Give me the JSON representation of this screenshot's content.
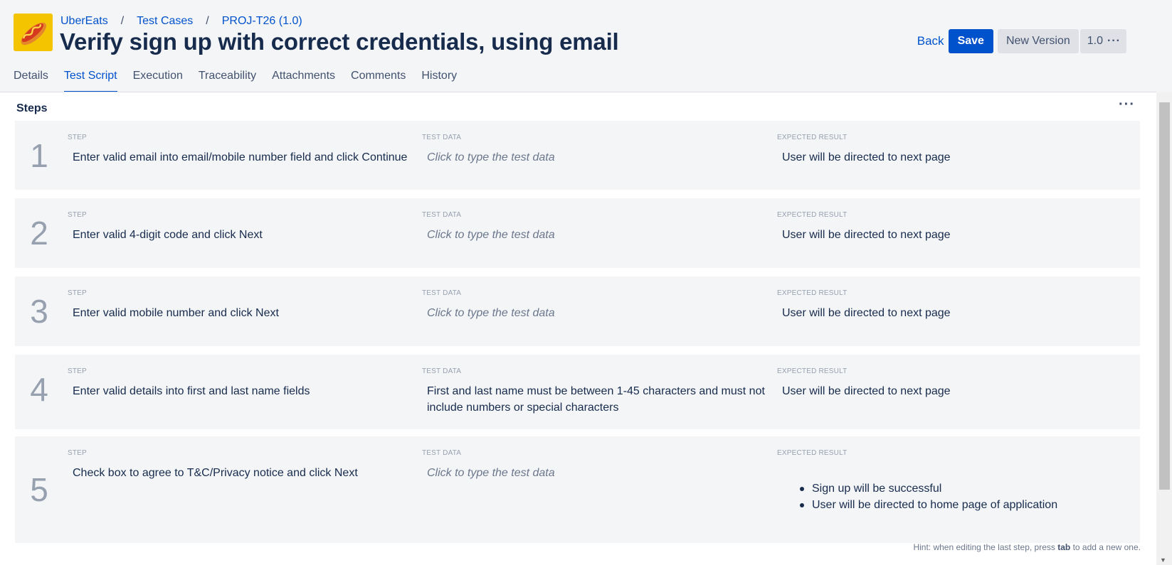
{
  "breadcrumb": [
    "UberEats",
    "Test Cases",
    "PROJ-T26 (1.0)"
  ],
  "title": "Verify sign up with correct credentials, using email",
  "actions": {
    "back": "Back",
    "save": "Save",
    "new_version": "New Version",
    "version": "1.0"
  },
  "tabs": [
    "Details",
    "Test Script",
    "Execution",
    "Traceability",
    "Attachments",
    "Comments",
    "History"
  ],
  "active_tab": "Test Script",
  "steps_title": "Steps",
  "column_labels": {
    "step": "STEP",
    "test_data": "TEST DATA",
    "expected": "EXPECTED RESULT"
  },
  "steps": [
    {
      "num": "1",
      "step": "Enter valid email into email/mobile number field and click Continue",
      "test_data": "Click to type the test data",
      "expected": "User will be directed to next page"
    },
    {
      "num": "2",
      "step": "Enter valid 4-digit code and click Next",
      "test_data": "Click to type the test data",
      "expected": "User will be directed to next page"
    },
    {
      "num": "3",
      "step": "Enter valid mobile number and click Next",
      "test_data": "Click to type the test data",
      "expected": "User will be directed to next page"
    },
    {
      "num": "4",
      "step": "Enter valid details into first and last name fields",
      "test_data_line1": "First and last name must be between 1-45 characters and must not",
      "test_data_line2": "include numbers or special characters",
      "expected": "User will be directed to next page"
    },
    {
      "num": "5",
      "step": "Check box to agree to T&C/Privacy notice and click Next",
      "test_data": "Click to type the test data",
      "expected_bullets": [
        "Sign up will be successful",
        "User will be directed to home page of application"
      ]
    }
  ],
  "hint": {
    "prefix": "Hint: when editing the last step, press",
    "key": "tab",
    "suffix": "to add a new one."
  },
  "colors": {
    "accent": "#0052cc",
    "logo_bg": "#f5c400",
    "row_bg": "#f4f5f7"
  }
}
